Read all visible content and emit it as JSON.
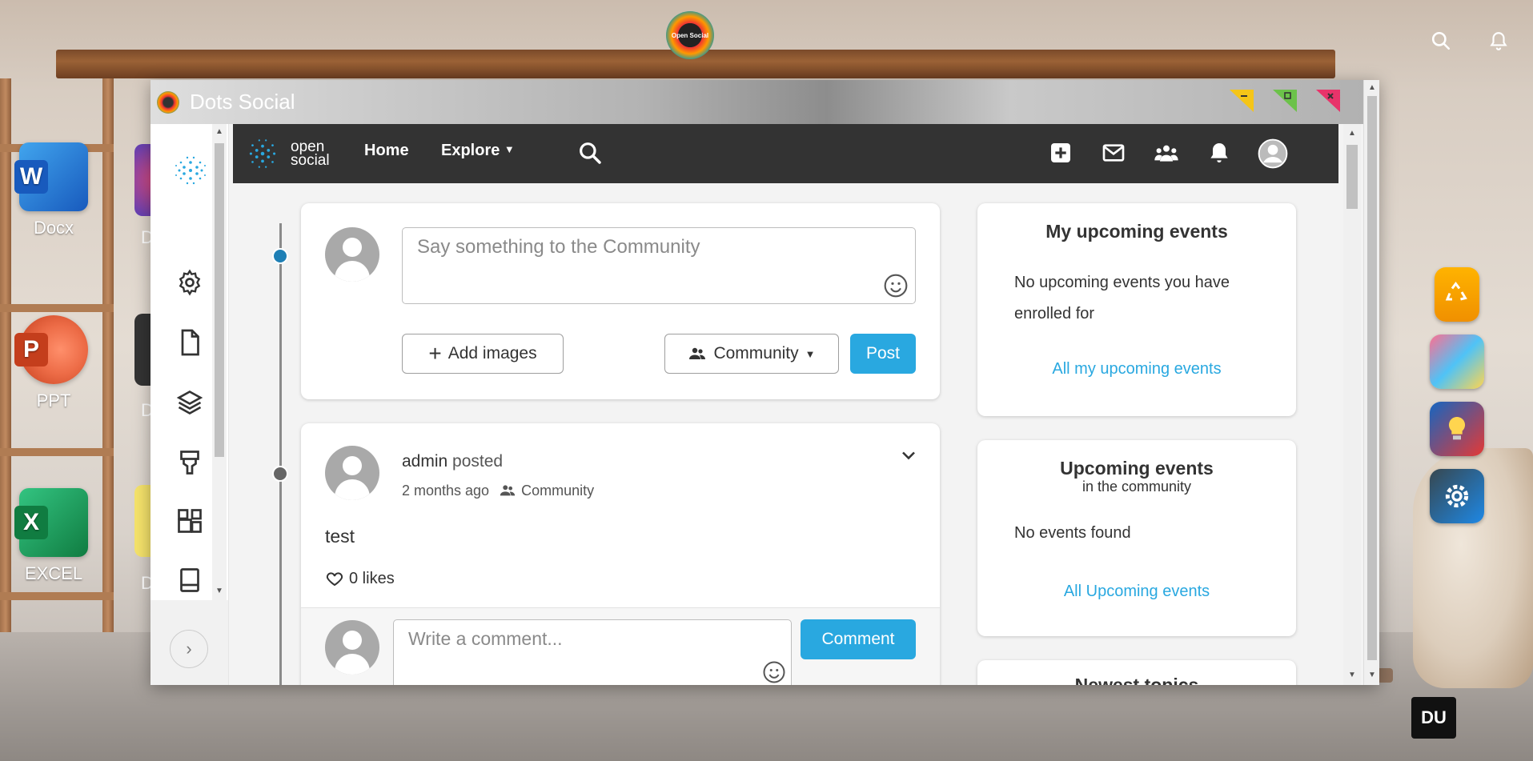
{
  "desktop": {
    "icons": [
      {
        "label": "Docx",
        "badge": "W"
      },
      {
        "label": "PPT",
        "badge": "P"
      },
      {
        "label": "EXCEL",
        "badge": "X"
      }
    ],
    "partial_labels": [
      "D",
      "D",
      "D"
    ],
    "top_logo_text": "Open Social",
    "corner_logo_text": "DU"
  },
  "window": {
    "title": "Dots Social"
  },
  "navbar": {
    "brand_line1": "open",
    "brand_line2": "social",
    "home": "Home",
    "explore": "Explore"
  },
  "composer": {
    "placeholder": "Say something to the Community",
    "add_images": "Add images",
    "visibility": "Community",
    "post": "Post"
  },
  "post": {
    "author": "admin",
    "action": "posted",
    "time": "2 months ago",
    "visibility": "Community",
    "body": "test",
    "likes": "0 likes",
    "comment_placeholder": "Write a comment...",
    "comment_button": "Comment"
  },
  "sidebar": {
    "my_events_title": "My upcoming events",
    "my_events_empty": "No upcoming events you have enrolled for",
    "my_events_link": "All my upcoming events",
    "community_title": "Upcoming events",
    "community_subtitle": "in the community",
    "community_empty": "No events found",
    "community_link": "All Upcoming events",
    "partial_title": "Newest topics"
  },
  "colors": {
    "accent": "#29a8e0",
    "navbar": "#333333"
  }
}
